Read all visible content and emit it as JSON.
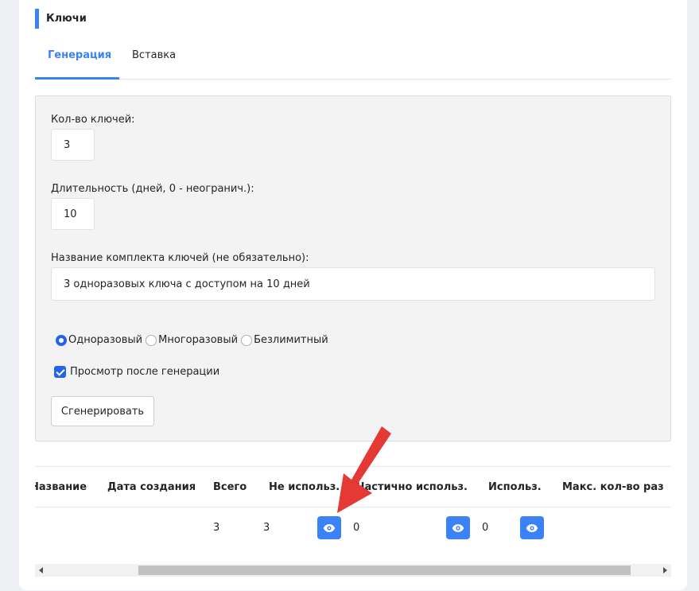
{
  "card": {
    "title": "Ключи"
  },
  "tabs": [
    {
      "label": "Генерация",
      "active": true
    },
    {
      "label": "Вставка",
      "active": false
    }
  ],
  "form": {
    "count_label": "Кол-во ключей:",
    "count_value": "3",
    "duration_label": "Длительность (дней, 0 - неогранич.):",
    "duration_value": "10",
    "name_label": "Название комплекта ключей (не обязательно):",
    "name_value": "3 одноразовых ключа с доступом на 10 дней",
    "radio_options": [
      {
        "label": "Одноразовый",
        "selected": true
      },
      {
        "label": "Многоразовый",
        "selected": false
      },
      {
        "label": "Безлимитный",
        "selected": false
      }
    ],
    "preview_label": "Просмотр после генерации",
    "preview_checked": true,
    "generate_button": "Сгенерировать"
  },
  "table": {
    "headers": [
      "Название",
      "Дата создания",
      "Всего",
      "Не использ.",
      "Частично использ.",
      "Использ.",
      "Макс. кол-во раз"
    ],
    "row": {
      "name": "",
      "date": "",
      "total": "3",
      "unused": "3",
      "partial": "0",
      "used": "0"
    }
  },
  "colors": {
    "accent": "#3b82f6",
    "annotation_arrow": "#e53935"
  },
  "icons": {
    "eye": "eye-icon",
    "scroll_left": "triangle-left-icon",
    "scroll_right": "triangle-right-icon"
  }
}
